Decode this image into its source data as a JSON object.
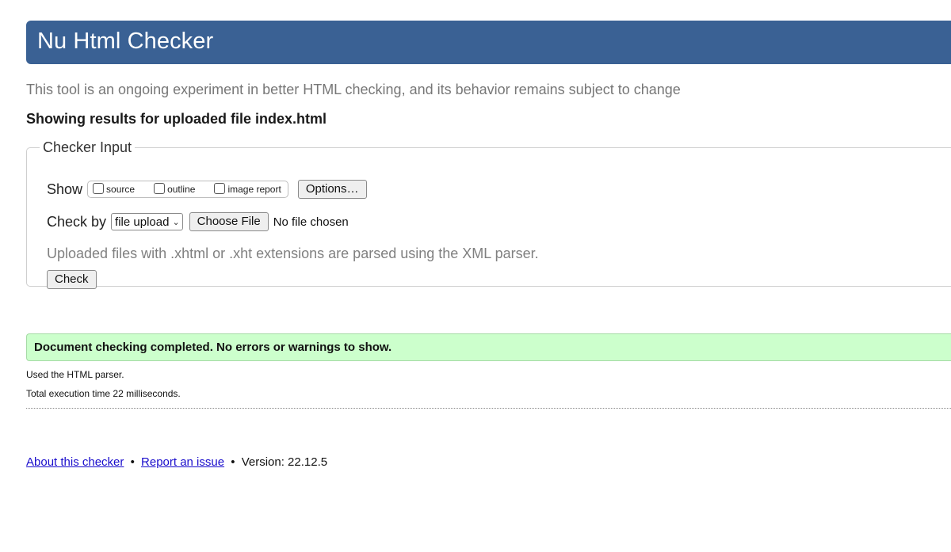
{
  "header": {
    "title": "Nu Html Checker"
  },
  "tagline": "This tool is an ongoing experiment in better HTML checking, and its behavior remains subject to change",
  "results_for": "Showing results for uploaded file index.html",
  "checker_input": {
    "legend": "Checker Input",
    "show_label": "Show",
    "show_options": [
      {
        "label": "source",
        "checked": false
      },
      {
        "label": "outline",
        "checked": false
      },
      {
        "label": "image report",
        "checked": false
      }
    ],
    "options_button": "Options…",
    "check_by_label": "Check by",
    "check_by_selected": "file upload",
    "choose_file_button": "Choose File",
    "no_file_text": "No file chosen",
    "parser_note": "Uploaded files with .xhtml or .xht extensions are parsed using the XML parser.",
    "check_button": "Check"
  },
  "result": {
    "success_message": "Document checking completed. No errors or warnings to show.",
    "success_color": "#ccffcc",
    "parser_used": "Used the HTML parser.",
    "execution_time": "Total execution time 22 milliseconds."
  },
  "footer": {
    "about_link": "About this checker",
    "separator": "•",
    "report_link": "Report an issue",
    "version": "Version: 22.12.5"
  },
  "colors": {
    "header_bg": "#3a6194",
    "link": "#1a0dcc"
  }
}
